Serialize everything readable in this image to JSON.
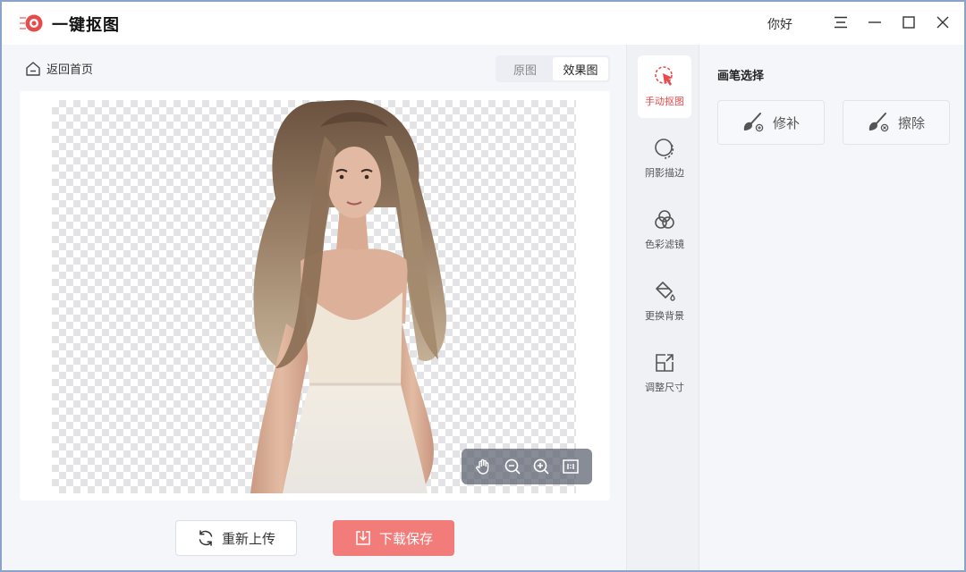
{
  "app": {
    "title": "一键抠图",
    "user": "你好",
    "brand_color": "#e84b4b"
  },
  "toolbar": {
    "back_label": "返回首页",
    "view_original": "原图",
    "view_result": "效果图",
    "active_view": "效果图"
  },
  "zoom_controls": {
    "icons": [
      "hand-icon",
      "zoom-out-icon",
      "zoom-in-icon",
      "actual-size-icon"
    ]
  },
  "actions": {
    "reupload_label": "重新上传",
    "download_label": "下载保存",
    "download_color": "#f17c7a"
  },
  "tools": [
    {
      "label": "手动抠图",
      "icon": "cursor-select-icon",
      "active": true
    },
    {
      "label": "阴影描边",
      "icon": "shadow-outline-icon",
      "active": false
    },
    {
      "label": "色彩滤镜",
      "icon": "color-filter-icon",
      "active": false
    },
    {
      "label": "更换背景",
      "icon": "paint-bucket-icon",
      "active": false
    },
    {
      "label": "调整尺寸",
      "icon": "resize-icon",
      "active": false
    }
  ],
  "panel": {
    "title": "画笔选择",
    "repair_label": "修补",
    "erase_label": "擦除"
  }
}
